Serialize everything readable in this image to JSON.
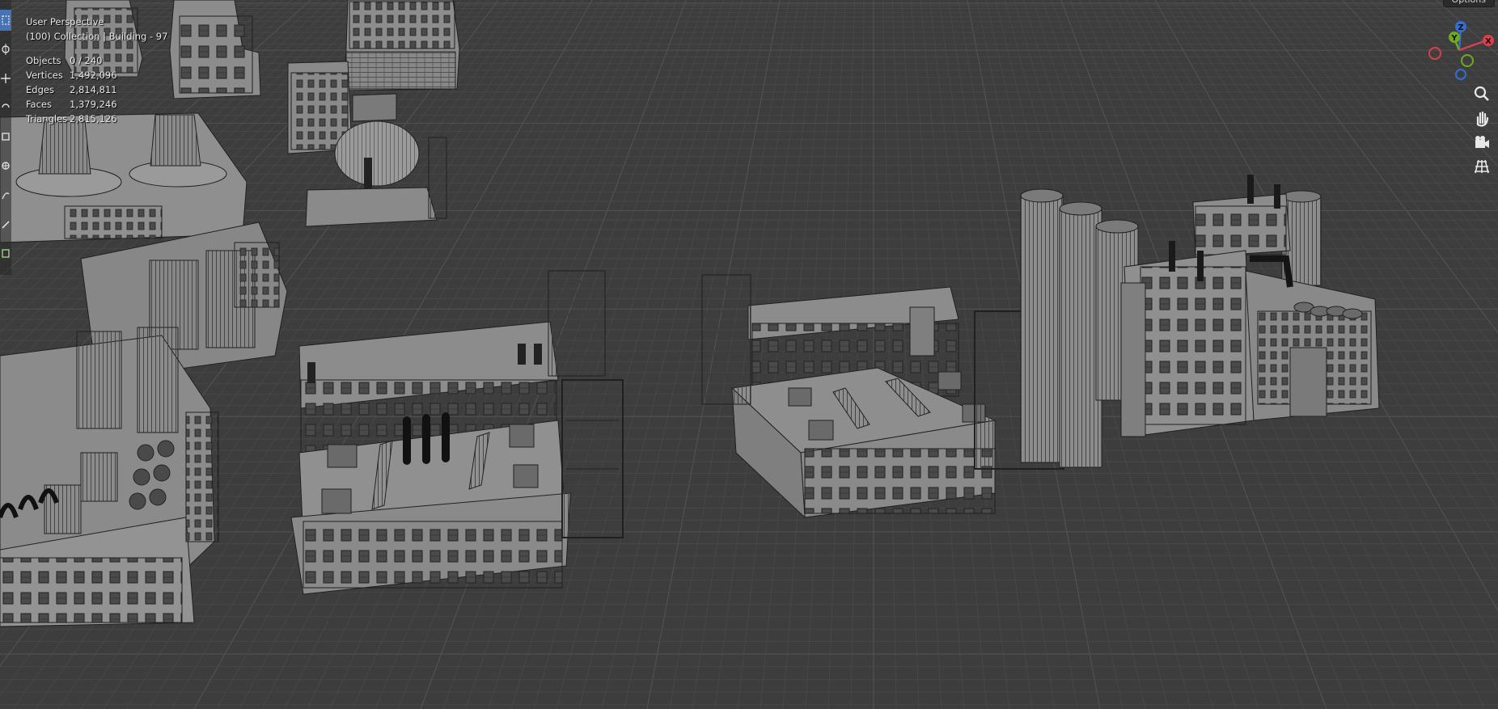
{
  "viewport": {
    "view_name": "User Perspective",
    "collection_info": "(100) Collection | Building - 97",
    "stats": [
      {
        "label": "Objects",
        "value": "0 / 240"
      },
      {
        "label": "Vertices",
        "value": "1,492,096"
      },
      {
        "label": "Edges",
        "value": "2,814,811"
      },
      {
        "label": "Faces",
        "value": "1,379,246"
      },
      {
        "label": "Triangles",
        "value": "2,815,126"
      }
    ],
    "options_label": "Options"
  },
  "gizmo": {
    "axes": [
      {
        "label": "Z",
        "color": "#2f6fd6"
      },
      {
        "label": "Y",
        "color": "#6ea81c"
      },
      {
        "label": "X",
        "color": "#d8404e"
      }
    ]
  },
  "navigation": [
    {
      "icon": "zoom-icon"
    },
    {
      "icon": "pan-hand-icon"
    },
    {
      "icon": "camera-icon"
    },
    {
      "icon": "ortho-grid-icon"
    }
  ],
  "toolbar": [
    {
      "icon": "select-box-icon",
      "active": true
    },
    {
      "icon": "cursor-icon"
    },
    {
      "icon": "move-icon"
    },
    {
      "icon": "rotate-icon"
    },
    {
      "icon": "scale-icon"
    },
    {
      "icon": "transform-icon"
    },
    {
      "icon": "annotate-icon"
    },
    {
      "icon": "measure-icon"
    },
    {
      "icon": "add-cube-icon"
    }
  ],
  "colors": {
    "background": "#3d3d3d",
    "grid_line": "#4a4a4a",
    "grid_major": "#525252",
    "building_light": "#9a9a9a",
    "building_face": "#858585",
    "building_dark": "#6e6e6e",
    "accent_active_tool": "#4772b3"
  }
}
